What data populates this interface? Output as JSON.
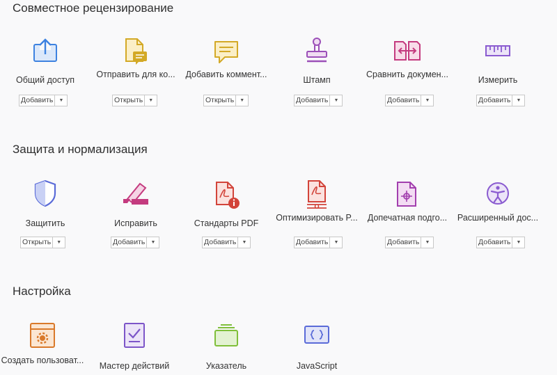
{
  "sections": [
    {
      "title": "Совместное рецензирование",
      "tools": [
        {
          "label": "Общий доступ",
          "button": "Добавить",
          "icon": "share-upload-icon"
        },
        {
          "label": "Отправить для ко...",
          "button": "Открыть",
          "icon": "send-comments-icon"
        },
        {
          "label": "Добавить коммент...",
          "button": "Открыть",
          "icon": "comment-icon"
        },
        {
          "label": "Штамп",
          "button": "Добавить",
          "icon": "stamp-icon"
        },
        {
          "label": "Сравнить докумен...",
          "button": "Добавить",
          "icon": "compare-documents-icon"
        },
        {
          "label": "Измерить",
          "button": "Добавить",
          "icon": "ruler-icon"
        }
      ]
    },
    {
      "title": "Защита и нормализация",
      "tools": [
        {
          "label": "Защитить",
          "button": "Открыть",
          "icon": "shield-icon"
        },
        {
          "label": "Исправить",
          "button": "Добавить",
          "icon": "redact-marker-icon"
        },
        {
          "label": "Стандарты PDF",
          "button": "Добавить",
          "icon": "pdf-standards-icon"
        },
        {
          "label": "Оптимизировать P...",
          "button": "Добавить",
          "icon": "optimize-pdf-icon"
        },
        {
          "label": "Допечатная подго...",
          "button": "Добавить",
          "icon": "print-production-icon"
        },
        {
          "label": "Расширенный дос...",
          "button": "Добавить",
          "icon": "accessibility-icon"
        }
      ]
    },
    {
      "title": "Настройка",
      "tools": [
        {
          "label": "Создать пользоват...",
          "icon": "custom-tool-icon"
        },
        {
          "label": "Мастер действий",
          "icon": "action-wizard-icon"
        },
        {
          "label": "Указатель",
          "icon": "index-icon"
        },
        {
          "label": "JavaScript",
          "icon": "javascript-icon"
        }
      ]
    }
  ]
}
